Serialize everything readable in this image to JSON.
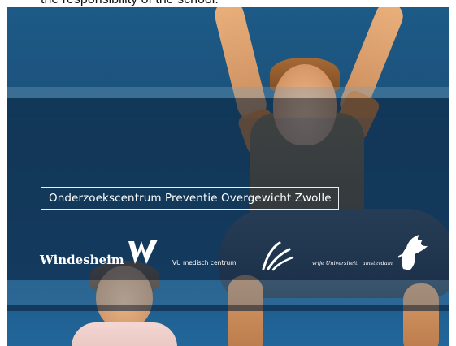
{
  "caption": {
    "text": "the responsibility of the school."
  },
  "slide": {
    "title": "Onderzoekscentrum Preventie Overgewicht Zwolle",
    "logos": {
      "windesheim": "Windesheim",
      "vumc": "VU medisch centrum",
      "vu_name": "vrije Universiteit",
      "vu_city": "amsterdam",
      "w_mark_icon": "windesheim-w-icon",
      "vumc_mark_icon": "vumc-swoosh-icon",
      "vu_mark_icon": "griffin-icon"
    },
    "colors": {
      "background": "#1d5a86",
      "band_dark": "#0f2846",
      "text": "#ffffff"
    }
  }
}
